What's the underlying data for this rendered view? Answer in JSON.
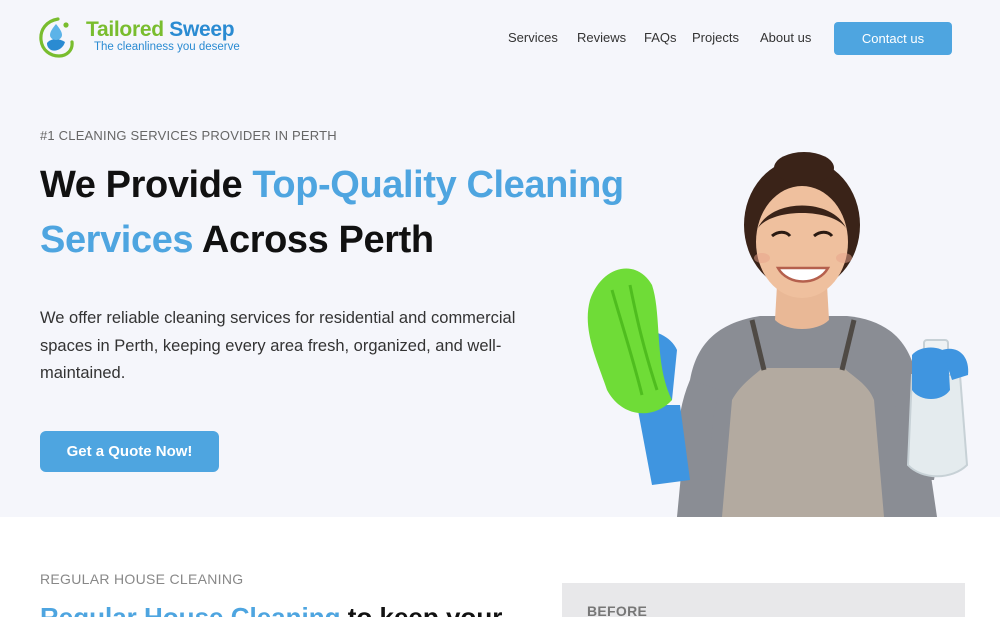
{
  "header": {
    "brand_part1": "Tailored",
    "brand_part2": "Sweep",
    "tagline": "The cleanliness you deserve",
    "nav": [
      "Services",
      "Reviews",
      "FAQs",
      "Projects",
      "About us"
    ],
    "contact_label": "Contact us"
  },
  "hero": {
    "eyebrow": "#1 CLEANING SERVICES PROVIDER IN PERTH",
    "headline_part1": "We Provide ",
    "headline_highlight": "Top-Quality Cleaning Services",
    "headline_part2": " Across Perth",
    "description": "We offer reliable cleaning services for residential and commercial spaces in Perth, keeping every area fresh, organized, and well-maintained.",
    "cta_label": "Get a Quote Now!"
  },
  "section2": {
    "eyebrow": "REGULAR HOUSE CLEANING",
    "title_highlight": "Regular House Cleaning",
    "title_rest": " to keep your",
    "before_label": "BEFORE"
  },
  "colors": {
    "accent": "#4ea5e0",
    "brand_green": "#79bd2e",
    "brand_blue": "#2a8bd2",
    "hero_bg": "#f5f6fb"
  },
  "icons": {
    "logo": "water-drop-swirl-icon"
  }
}
